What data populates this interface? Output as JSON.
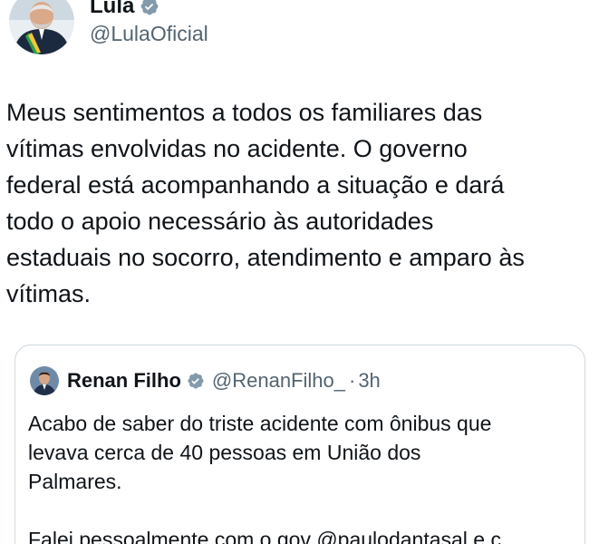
{
  "author": {
    "name": "Lula",
    "handle": "@LulaOficial",
    "avatar_icon": "avatar-lula",
    "verified_icon": "verified-badge-icon"
  },
  "tweet": {
    "lines": [
      "Meus sentimentos a todos os familiares das",
      "vítimas envolvidas no acidente. O governo",
      "federal está acompanhando a situação e dará",
      "todo o apoio necessário às autoridades",
      "estaduais no socorro, atendimento e amparo às",
      "vítimas."
    ]
  },
  "quote": {
    "name": "Renan Filho",
    "handle": "@RenanFilho_",
    "separator": "·",
    "time": "3h",
    "lines": [
      "Acabo de saber do triste acidente com ônibus que",
      "levava cerca de 40 pessoas em União dos",
      "Palmares.",
      "",
      "Falei pessoalmente com o gov @paulodantasal e c..."
    ]
  },
  "colors": {
    "text": "#0f1419",
    "secondary": "#536471",
    "verified": "#829aab",
    "border": "#cfd9de"
  }
}
